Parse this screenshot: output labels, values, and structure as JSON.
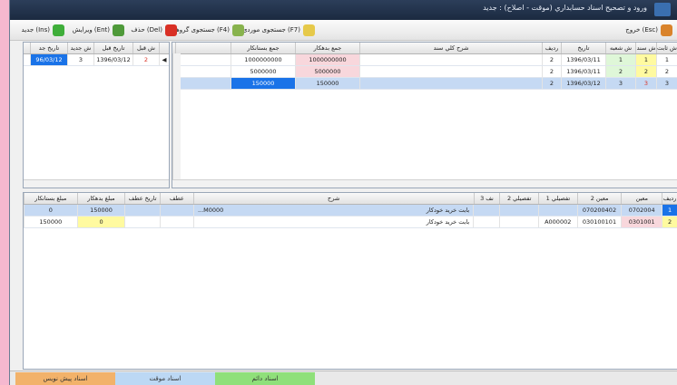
{
  "window": {
    "title": "ورود و تصحيح اسناد حسابداري (موقت - اصلاح) : جديد"
  },
  "toolbar": {
    "exit": "خروج (Esc)",
    "search_doc": "جستجوی موردی (F7)",
    "search_group": "جستجوی گروهی (F4)",
    "delete": "حذف (Del)",
    "edit": "ويرايش (Ent)",
    "new": "جديد (Ins)"
  },
  "top_grid": {
    "headers": [
      "ش ثابت",
      "ش سند",
      "ش شعبه",
      "تاريخ",
      "رديف",
      "شرح كلي سند",
      "جمع بدهكار",
      "جمع بستانكار"
    ],
    "rows": [
      {
        "fixed": "1",
        "doc": "1",
        "branch": "1",
        "date": "1396/03/11",
        "seq": "2",
        "desc": "",
        "debit": "1000000000",
        "credit": "1000000000"
      },
      {
        "fixed": "2",
        "doc": "2",
        "branch": "2",
        "date": "1396/03/11",
        "seq": "2",
        "desc": "",
        "debit": "5000000",
        "credit": "5000000"
      },
      {
        "fixed": "3",
        "doc": "3",
        "branch": "3",
        "date": "1396/03/12",
        "seq": "2",
        "desc": "",
        "debit": "150000",
        "credit": "150000"
      }
    ]
  },
  "side_grid": {
    "headers": [
      "ش قبل",
      "تاريخ قبل",
      "ش جديد",
      "تاريخ جد"
    ],
    "rows": [
      {
        "prev": "2",
        "prev_date": "1396/03/12",
        "new": "3",
        "new_date": "96/03/12"
      }
    ]
  },
  "bottom_grid": {
    "headers": [
      "رديف",
      "معين",
      "معين 2",
      "تفصيلي 1",
      "تفصيلي 2",
      "نف 3",
      "شرح",
      "عطف",
      "تاريخ عطف",
      "مبلغ بدهكار",
      "مبلغ بستانكار"
    ],
    "rows": [
      {
        "seq": "1",
        "moein": "0702004",
        "moein2": "070200402",
        "taf1": "",
        "taf2": "",
        "taf3": "",
        "desc": "بابت خريد خودكار",
        "code": "M0000...",
        "atf": "",
        "atf_date": "",
        "debit": "150000",
        "credit": "0"
      },
      {
        "seq": "2",
        "moein": "0301001",
        "moein2": "030100101",
        "taf1": "A000002",
        "taf2": "",
        "taf3": "",
        "desc": "بابت خريد خودكار",
        "code": "",
        "atf": "",
        "atf_date": "",
        "debit": "0",
        "credit": "150000"
      }
    ]
  },
  "status_tabs": {
    "permanent": "اسناد دائم",
    "temporary": "اسناد موقت",
    "draft": "اسناد پيش نويس"
  },
  "colors": {
    "accent": "#1a73e8",
    "yellow": "#fffaa0",
    "pink": "#f8d7dc",
    "green_tab": "#8fe07a",
    "blue_tab": "#bcd8f4",
    "orange_tab": "#f2b26a"
  }
}
